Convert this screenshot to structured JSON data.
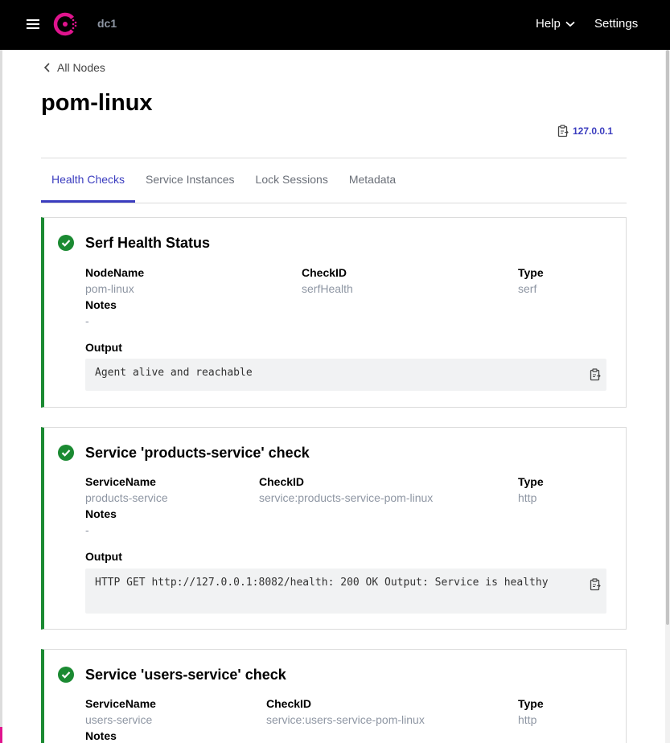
{
  "header": {
    "datacenter": "dc1",
    "help_label": "Help",
    "settings_label": "Settings",
    "brand_color": "#e0148e"
  },
  "breadcrumb": {
    "label": "All Nodes"
  },
  "page": {
    "title": "pom-linux",
    "address": "127.0.0.1"
  },
  "tabs": [
    {
      "label": "Health Checks",
      "active": true
    },
    {
      "label": "Service Instances",
      "active": false
    },
    {
      "label": "Lock Sessions",
      "active": false
    },
    {
      "label": "Metadata",
      "active": false
    }
  ],
  "checks": [
    {
      "title": "Serf Health Status",
      "status": "passing",
      "field1_label": "NodeName",
      "field1_value": "pom-linux",
      "check_id_label": "CheckID",
      "check_id": "serfHealth",
      "type_label": "Type",
      "type": "serf",
      "notes_label": "Notes",
      "notes": "-",
      "output_label": "Output",
      "output": "Agent alive and reachable"
    },
    {
      "title": "Service 'products-service' check",
      "status": "passing",
      "field1_label": "ServiceName",
      "field1_value": "products-service",
      "check_id_label": "CheckID",
      "check_id": "service:products-service-pom-linux",
      "type_label": "Type",
      "type": "http",
      "notes_label": "Notes",
      "notes": "-",
      "output_label": "Output",
      "output": "HTTP GET http://127.0.0.1:8082/health: 200 OK Output: Service is healthy"
    },
    {
      "title": "Service 'users-service' check",
      "status": "passing",
      "field1_label": "ServiceName",
      "field1_value": "users-service",
      "check_id_label": "CheckID",
      "check_id": "service:users-service-pom-linux",
      "type_label": "Type",
      "type": "http",
      "notes_label": "Notes"
    }
  ],
  "colors": {
    "passing": "#1b8a32",
    "tab_active": "#3b3dbf",
    "muted_text": "#8e96a3"
  },
  "icons": [
    "menu-icon",
    "consul-logo",
    "chevron-down-icon",
    "chevron-left-icon",
    "clipboard-icon",
    "check-circle-icon"
  ]
}
